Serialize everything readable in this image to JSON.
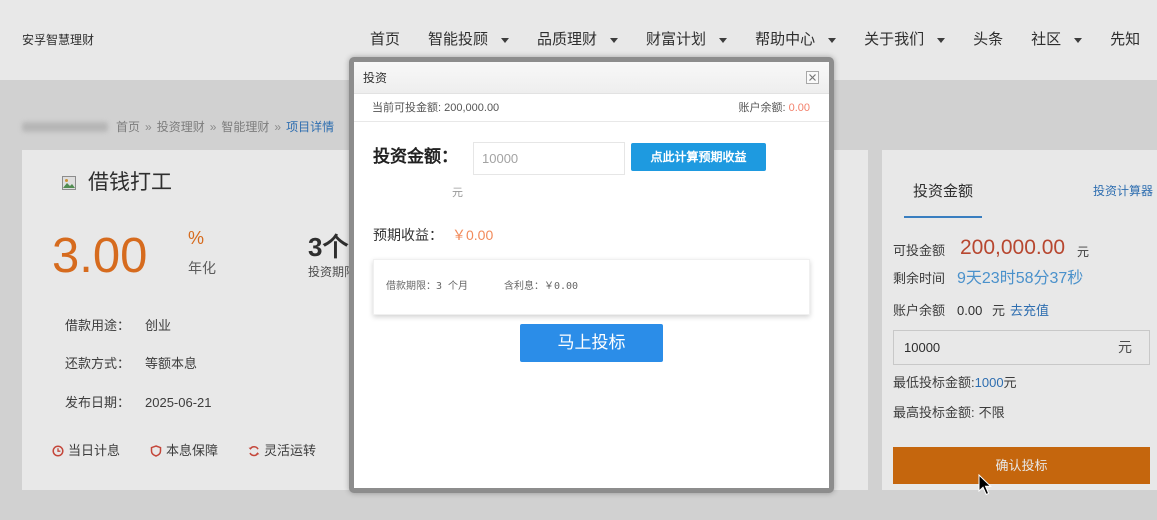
{
  "header": {
    "logo": "安孚智慧理财",
    "nav": [
      {
        "label": "首页",
        "dropdown": false
      },
      {
        "label": "智能投顾",
        "dropdown": true
      },
      {
        "label": "品质理财",
        "dropdown": true
      },
      {
        "label": "财富计划",
        "dropdown": true
      },
      {
        "label": "帮助中心",
        "dropdown": true
      },
      {
        "label": "关于我们",
        "dropdown": true
      },
      {
        "label": "头条",
        "dropdown": false
      },
      {
        "label": "社区",
        "dropdown": true
      },
      {
        "label": "先知",
        "dropdown": false
      }
    ]
  },
  "breadcrumb": {
    "separator": "»",
    "items": [
      "首页",
      "投资理财",
      "智能理财",
      "项目详情"
    ]
  },
  "project": {
    "image_icon": "broken-image-icon",
    "title": "借钱打工",
    "rate_value": "3.00",
    "rate_unit": "%",
    "rate_label": "年化",
    "term_value": "3个",
    "term_label": "投资期限",
    "details": [
      {
        "label": "借款用途：",
        "value": "创业"
      },
      {
        "label": "还款方式：",
        "value": "等额本息"
      },
      {
        "label": "发布日期：",
        "value": "2025-06-21"
      }
    ],
    "features": [
      {
        "icon": "clock-icon",
        "label": "当日计息"
      },
      {
        "icon": "shield-icon",
        "label": "本息保障"
      },
      {
        "icon": "refresh-icon",
        "label": "灵活运转"
      }
    ]
  },
  "invest_panel": {
    "tab": "投资金额",
    "calculator_link": "投资计算器",
    "available_label": "可投金额",
    "available_value": "200,000.00",
    "available_unit": "元",
    "remaining_label": "剩余时间",
    "remaining_value": "9天23时58分37秒",
    "balance_label": "账户余额",
    "balance_value": "0.00",
    "balance_unit": "元",
    "recharge_link": "去充值",
    "amount_value": "10000",
    "amount_unit": "元",
    "min_label": "最低投标金额:",
    "min_value": "1000",
    "min_unit": "元",
    "max_label": "最高投标金额:",
    "max_value": "不限",
    "confirm_button": "确认投标"
  },
  "modal": {
    "title": "投资",
    "close_icon": "close-icon",
    "available_label": "当前可投金额:",
    "available_value": "200,000.00",
    "balance_label": "账户余额:",
    "balance_value": "0.00",
    "amount_label": "投资金额：",
    "amount_placeholder": "10000",
    "amount_unit": "元",
    "calc_button": "点此计算预期收益",
    "expected_label": "预期收益：",
    "expected_value": "￥0.00",
    "summary_term": "借款期限：3 个月",
    "summary_interest": "含利息：￥0.00",
    "submit_button": "马上投标"
  },
  "cursor_icon": "mouse-cursor-icon",
  "colors": {
    "rate_orange": "#ec7622",
    "amount_red": "#ca4f35",
    "link_blue": "#3379c2",
    "time_blue": "#52a0e0",
    "tab_blue": "#3f8bd4",
    "icon_red": "#d84e40",
    "confirm_orange": "#d9710f",
    "calc_blue": "#1e9ae0",
    "submit_blue": "#2b8de8",
    "soft_orange": "#f28a5a",
    "balance_orange": "#f3806b"
  }
}
